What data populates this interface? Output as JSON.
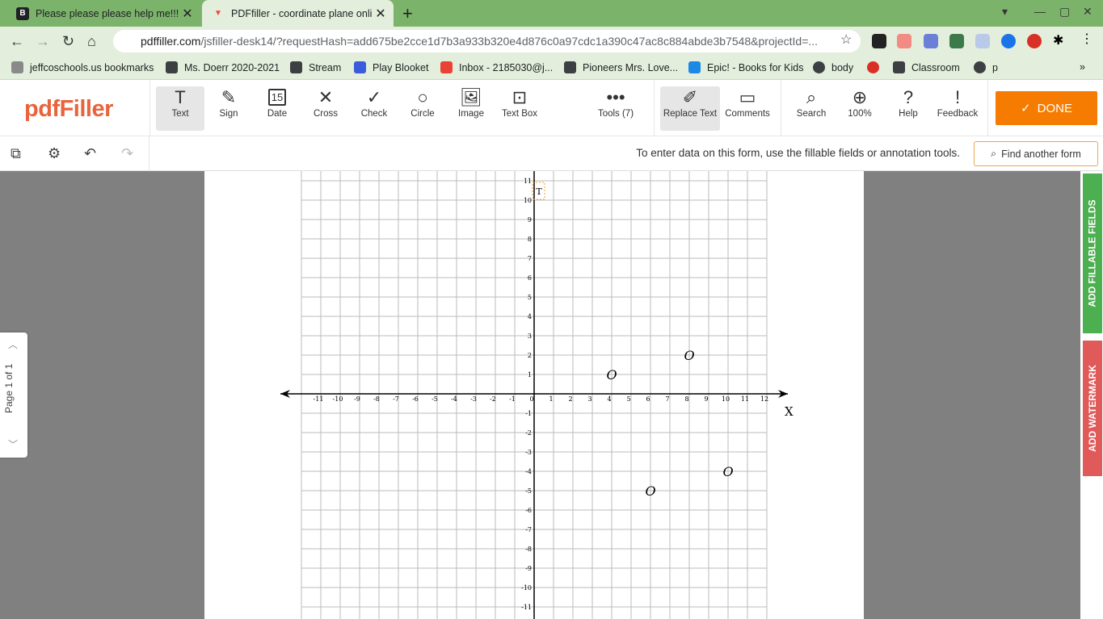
{
  "browser": {
    "tabs": [
      {
        "title": "Please please please help me!!! I",
        "favicon": "B"
      },
      {
        "title": "PDFfiller - coordinate plane onlin",
        "favicon": "▼"
      }
    ],
    "url_host": "pdffiller.com",
    "url_path": "/jsfiller-desk14/?requestHash=add675be2cce1d7b3a933b320e4d876c0a97cdc1a390c47ac8c884abde3b7548&projectId=...",
    "bookmarks": [
      "jeffcoschools.us bookmarks",
      "Ms. Doerr 2020-2021",
      "Stream",
      "Play Blooket",
      "Inbox - 2185030@j...",
      "Pioneers Mrs. Love...",
      "Epic! - Books for Kids",
      "body",
      "Classroom",
      "p"
    ]
  },
  "app": {
    "logo": "pdfFiller",
    "tools": {
      "text": "Text",
      "sign": "Sign",
      "date": "Date",
      "cross": "Cross",
      "check": "Check",
      "circle": "Circle",
      "image": "Image",
      "textbox": "Text Box",
      "more": "Tools (7)",
      "replace": "Replace Text",
      "comments": "Comments",
      "search": "Search",
      "zoom": "100%",
      "help": "Help",
      "feedback": "Feedback"
    },
    "done": "DONE",
    "hint": "To enter data on this form, use the fillable fields or annotation tools.",
    "find_another": "Find another form",
    "page_indicator": "Page 1 of 1",
    "right_tabs": {
      "fillable": "ADD FILLABLE FIELDS",
      "watermark": "ADD WATERMARK"
    },
    "date_icon_num": "15"
  },
  "graph": {
    "x_label": "X",
    "text_marker": "T",
    "x_range": [
      -11,
      12
    ],
    "y_range": [
      -11,
      11
    ],
    "points": [
      {
        "x": 4,
        "y": 1,
        "label": "O"
      },
      {
        "x": 8,
        "y": 2,
        "label": "O"
      },
      {
        "x": 10,
        "y": -4,
        "label": "O"
      },
      {
        "x": 6,
        "y": -5,
        "label": "O"
      }
    ]
  },
  "colors": {
    "accent": "#f57c00",
    "logo": "#e8643c",
    "fillable_tab": "#4caf50",
    "watermark_tab": "#e05a5a"
  }
}
